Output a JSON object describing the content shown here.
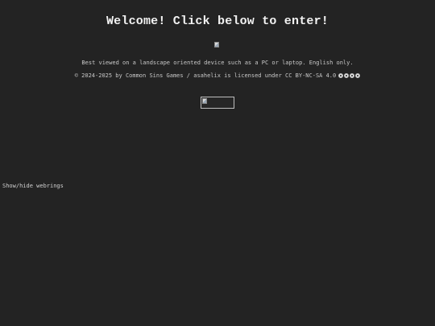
{
  "header": {
    "title": "Welcome! Click below to enter!"
  },
  "notice": {
    "text": "Best viewed on a landscape oriented device such as a PC or laptop. English only."
  },
  "license": {
    "text": "© 2024-2025 by Common Sins Games / asahelix is licensed under CC BY-NC-SA 4.0",
    "icons": [
      "cc-icon",
      "by-icon",
      "nc-icon",
      "sa-icon"
    ]
  },
  "webrings": {
    "toggle_label": "Show/hide webrings"
  },
  "colors": {
    "background": "#232323",
    "text": "#cfcfcf",
    "title": "#f2f2f2"
  }
}
